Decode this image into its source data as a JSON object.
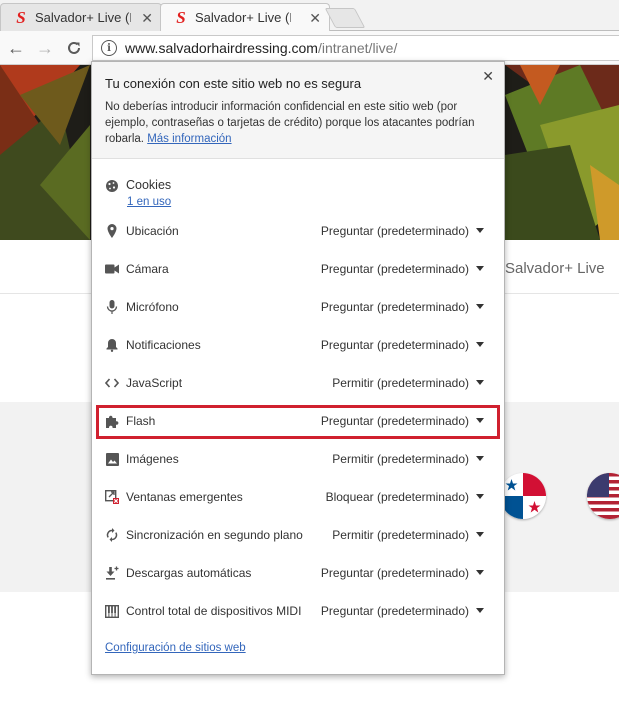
{
  "browser": {
    "tabs": [
      {
        "title": "Salvador+ Live (I",
        "state": "inactive"
      },
      {
        "title": "Salvador+ Live (I",
        "state": "active"
      }
    ],
    "favicon_letter": "S",
    "url_host": "www.salvadorhairdressing.com",
    "url_path": "/intranet/live/"
  },
  "page": {
    "nav_item": "Salvador+ Live"
  },
  "site_info": {
    "title": "Tu conexión con este sitio web no es segura",
    "description": "No deberías introducir información confidencial en este sitio web (por ejemplo, contraseñas o tarjetas de crédito) porque los atacantes podrían robarla.",
    "more_info_link": "Más información",
    "cookies": {
      "label": "Cookies",
      "link": "1 en uso"
    },
    "permissions": [
      {
        "icon": "location-pin-icon",
        "label": "Ubicación",
        "value": "Preguntar (predeterminado)"
      },
      {
        "icon": "camera-icon",
        "label": "Cámara",
        "value": "Preguntar (predeterminado)"
      },
      {
        "icon": "microphone-icon",
        "label": "Micrófono",
        "value": "Preguntar (predeterminado)"
      },
      {
        "icon": "bell-icon",
        "label": "Notificaciones",
        "value": "Preguntar (predeterminado)"
      },
      {
        "icon": "code-brackets-icon",
        "label": "JavaScript",
        "value": "Permitir (predeterminado)"
      },
      {
        "icon": "puzzle-piece-icon",
        "label": "Flash",
        "value": "Preguntar (predeterminado)",
        "highlighted": true
      },
      {
        "icon": "image-icon",
        "label": "Imágenes",
        "value": "Permitir (predeterminado)"
      },
      {
        "icon": "popup-window-icon",
        "label": "Ventanas emergentes",
        "value": "Bloquear (predeterminado)"
      },
      {
        "icon": "sync-icon",
        "label": "Sincronización en segundo plano",
        "value": "Permitir (predeterminado)"
      },
      {
        "icon": "download-icon",
        "label": "Descargas automáticas",
        "value": "Preguntar (predeterminado)"
      },
      {
        "icon": "piano-keys-icon",
        "label": "Control total de dispositivos MIDI",
        "value": "Preguntar (predeterminado)"
      }
    ],
    "footer_link": "Configuración de sitios web"
  },
  "colors": {
    "highlight_border": "#d0202f",
    "link": "#3366bb",
    "favicon": "#e2201f"
  }
}
